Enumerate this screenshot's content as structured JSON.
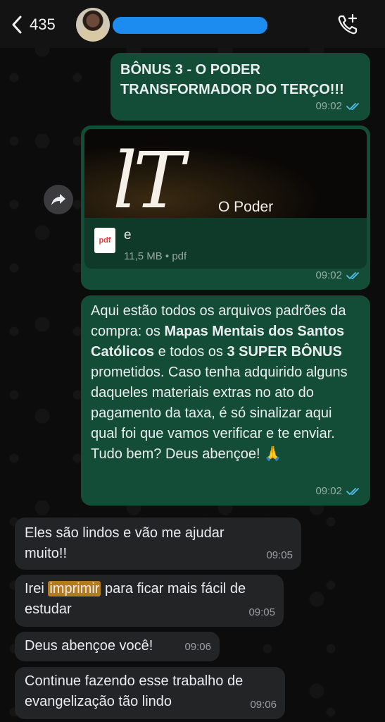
{
  "header": {
    "back_count": "435",
    "contact_name": "",
    "avatar": "avatar",
    "call_icon": "phone-add-icon"
  },
  "messages": [
    {
      "direction": "out",
      "text": "BÔNUS 3 - O PODER TRANSFORMADOR DO TERÇO!!!",
      "time": "09:02",
      "status": "read"
    },
    {
      "direction": "out",
      "type": "document",
      "preview_title": "O Poder Transformador",
      "file_name": "e",
      "file_info": "11,5 MB • pdf",
      "file_type_label": "pdf",
      "time": "09:02",
      "status": "read"
    },
    {
      "direction": "out",
      "parts": [
        "Aqui estão todos os arquivos padrões da compra: os ",
        "Mapas Mentais dos Santos Católicos",
        " e todos os ",
        "3 SUPER BÔNUS",
        " prometidos. Caso tenha adquirido alguns daqueles materiais extras no ato do pagamento da taxa, é só sinalizar aqui qual foi que vamos verificar e te enviar. Tudo bem? Deus abençoe! 🙏"
      ],
      "time": "09:02",
      "status": "read"
    },
    {
      "direction": "in",
      "text": "Eles são lindos e vão me ajudar muito!!",
      "time": "09:05"
    },
    {
      "direction": "in",
      "text_before": "Irei ",
      "highlight": "imprimir",
      "text_after": " para ficar mais fácil de estudar",
      "time": "09:05"
    },
    {
      "direction": "in",
      "text": "Deus abençoe você!",
      "time": "09:06"
    },
    {
      "direction": "in",
      "text": "Continue fazendo esse trabalho de evangelização tão lindo",
      "time": "09:06"
    }
  ],
  "colors": {
    "outgoing_bubble": "#144d37",
    "incoming_bubble": "#222426",
    "read_ticks": "#53bdeb",
    "highlight": "#b47a1e"
  }
}
